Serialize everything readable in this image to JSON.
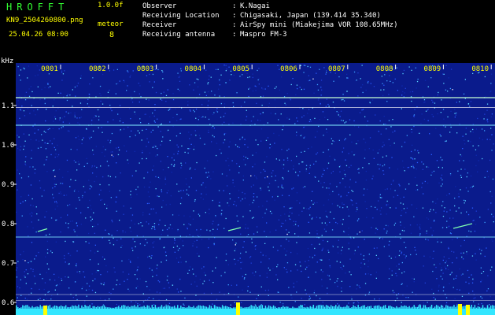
{
  "header": {
    "app_title": "HROFFT",
    "version": "1.0.0f",
    "filename": "KN9_2504260800.png",
    "meteor_label": "meteor",
    "datetime": "25.04.26 08:00",
    "meteor_count": "8"
  },
  "info": [
    {
      "key": "Observer",
      "value": "K.Nagai"
    },
    {
      "key": "Receiving Location",
      "value": "Chigasaki, Japan (139.414 35.340)"
    },
    {
      "key": "Receiver",
      "value": "AirSpy mini (Miakejima VOR 108.65MHz)"
    },
    {
      "key": "Receiving antenna",
      "value": "Maspro FM-3"
    }
  ],
  "axis": {
    "y_unit": "kHz",
    "y_ticks": [
      "1.1",
      "1.0",
      "0.9",
      "0.8",
      "0.7",
      "0.6"
    ],
    "x_ticks": [
      "0801",
      "0802",
      "0803",
      "0804",
      "0805",
      "0806",
      "0807",
      "0808",
      "0809",
      "0810"
    ]
  },
  "colors": {
    "background": "#000000",
    "spectrogram_base": "#0a1b8c",
    "header_text_green": "#33ff33",
    "header_text_yellow": "#ffff00",
    "trace_line": "#7fffd4",
    "bottom_bar": "#33e6ff",
    "meteor_marker": "#ffff00"
  }
}
